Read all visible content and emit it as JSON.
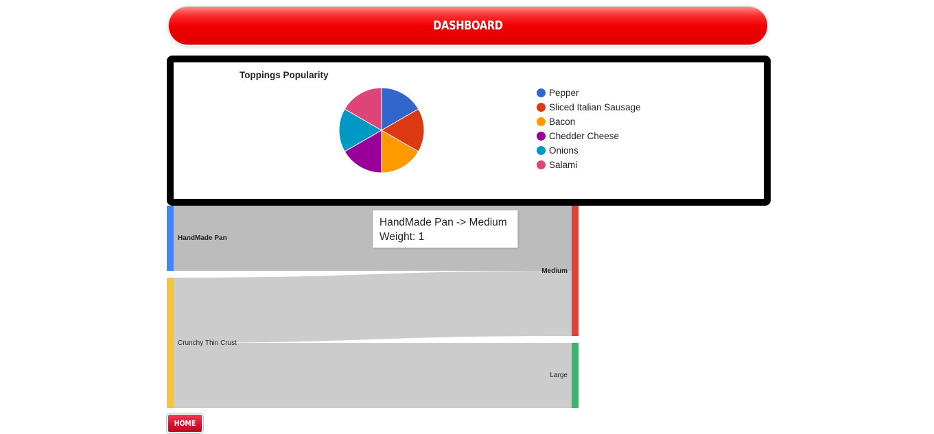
{
  "header": {
    "title": "DASHBOARD"
  },
  "chart_data": {
    "type": "pie",
    "title": "Toppings Popularity",
    "categories": [
      "Pepper",
      "Sliced Italian Sausage",
      "Bacon",
      "Chedder Cheese",
      "Onions",
      "Salami"
    ],
    "values": [
      1,
      1,
      1,
      1,
      1,
      1
    ],
    "colors": [
      "#3366cc",
      "#dc3912",
      "#ff9900",
      "#990099",
      "#0099c6",
      "#dd4477"
    ],
    "legend_position": "right"
  },
  "sankey": {
    "nodes": [
      {
        "name": "HandMade Pan",
        "color": "#4285f4"
      },
      {
        "name": "Crunchy Thin Crust",
        "color": "#f4c542"
      },
      {
        "name": "Medium",
        "color": "#db4437"
      },
      {
        "name": "Large",
        "color": "#3cb371"
      }
    ],
    "links": [
      {
        "source": "HandMade Pan",
        "target": "Medium",
        "weight": 1
      },
      {
        "source": "Crunchy Thin Crust",
        "target": "Medium",
        "weight": 1
      },
      {
        "source": "Crunchy Thin Crust",
        "target": "Large",
        "weight": 1
      }
    ],
    "tooltip": {
      "line1": "HandMade Pan -> Medium",
      "line2": "Weight: 1"
    }
  },
  "footer": {
    "home_label": "HOME"
  }
}
